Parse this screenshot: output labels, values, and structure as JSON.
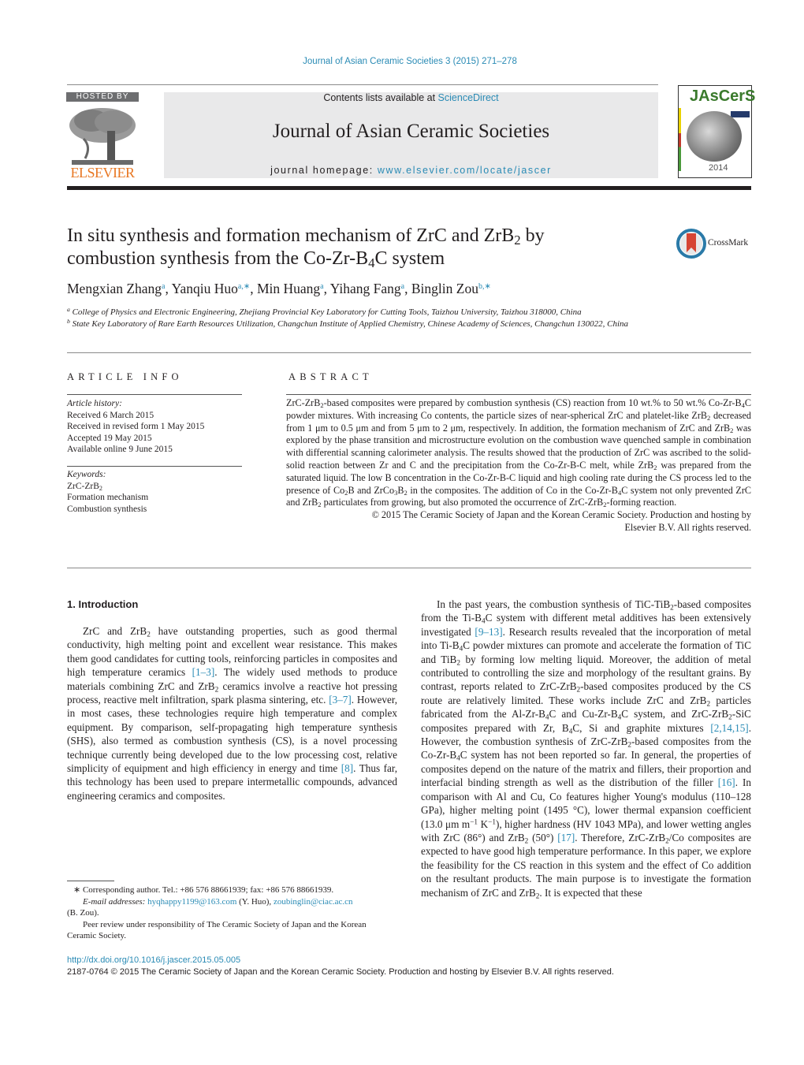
{
  "header": {
    "citation": "Journal of Asian Ceramic Societies 3 (2015) 271–278",
    "hosted_by": "HOSTED BY",
    "publisher_wordmark": "ELSEVIER",
    "contents_prefix": "Contents lists available at ",
    "contents_link": "ScienceDirect",
    "journal_name": "Journal of Asian Ceramic Societies",
    "homepage_prefix": "journal homepage: ",
    "homepage_link": "www.elsevier.com/locate/jascer",
    "cover_title": "JAsCerS",
    "cover_year": "2014",
    "colors": {
      "link": "#2a8bb5",
      "elsevier_orange": "#e87722",
      "banner_bg": "#e9e9ea"
    }
  },
  "article": {
    "title_part1": "In situ synthesis and formation mechanism of ZrC and ZrB",
    "title_sub1": "2",
    "title_part2": " by",
    "title_line2a": "combustion synthesis from the Co-Zr-B",
    "title_sub2": "4",
    "title_line2b": "C system",
    "crossmark_label": "CrossMark",
    "authors": [
      {
        "name": "Mengxian Zhang",
        "sup": "a"
      },
      {
        "name": "Yanqiu Huo",
        "sup": "a,∗"
      },
      {
        "name": "Min Huang",
        "sup": "a"
      },
      {
        "name": "Yihang Fang",
        "sup": "a"
      },
      {
        "name": "Binglin Zou",
        "sup": "b,∗"
      }
    ],
    "affiliations": [
      {
        "mark": "a",
        "text": "College of Physics and Electronic Engineering, Zhejiang Provincial Key Laboratory for Cutting Tools, Taizhou University, Taizhou 318000, China"
      },
      {
        "mark": "b",
        "text": "State Key Laboratory of Rare Earth Resources Utilization, Changchun Institute of Applied Chemistry, Chinese Academy of Sciences, Changchun 130022, China"
      }
    ]
  },
  "article_info": {
    "heading": "ARTICLE INFO",
    "history_label": "Article history:",
    "history": [
      "Received 6 March 2015",
      "Received in revised form 1 May 2015",
      "Accepted 19 May 2015",
      "Available online 9 June 2015"
    ],
    "keywords_label": "Keywords:",
    "keyword1_base": "ZrC-ZrB",
    "keyword1_sub": "2",
    "keywords": [
      "Formation mechanism",
      "Combustion synthesis"
    ]
  },
  "abstract": {
    "heading": "ABSTRACT",
    "copyright_line1": "© 2015 The Ceramic Society of Japan and the Korean Ceramic Society. Production and hosting by",
    "copyright_line2": "Elsevier B.V. All rights reserved."
  },
  "introduction": {
    "heading": "1.  Introduction",
    "refs": [
      "[1–3]",
      "[3–7]",
      "[8]",
      "[9–13]",
      "[2,14,15]",
      "[16]",
      "[17]"
    ]
  },
  "footnotes": {
    "corresponding": "∗  Corresponding author. Tel.: +86 576 88661939; fax: +86 576 88661939.",
    "email_label": "E-mail addresses: ",
    "email1": "hyqhappy1199@163.com",
    "email1_owner": " (Y. Huo), ",
    "email2": "zoubinglin@ciac.ac.cn",
    "email2_owner": "(B. Zou).",
    "peer_review": "Peer review under responsibility of The Ceramic Society of Japan and the Korean Ceramic Society."
  },
  "doi": {
    "link": "http://dx.doi.org/10.1016/j.jascer.2015.05.005",
    "issn_line": "2187-0764 © 2015 The Ceramic Society of Japan and the Korean Ceramic Society. Production and hosting by Elsevier B.V. All rights reserved."
  }
}
